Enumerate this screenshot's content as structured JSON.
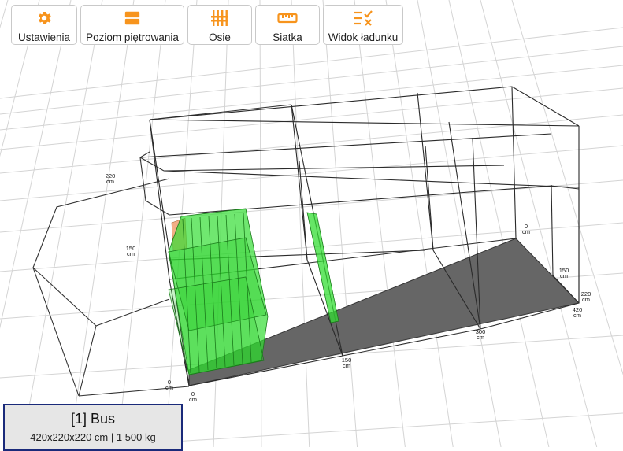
{
  "toolbar": {
    "buttons": [
      {
        "label": "Ustawienia",
        "icon": "gear-icon"
      },
      {
        "label": "Poziom piętrowania",
        "icon": "stack-layers-icon"
      },
      {
        "label": "Osie",
        "icon": "axles-icon"
      },
      {
        "label": "Siatka",
        "icon": "ruler-icon"
      },
      {
        "label": "Widok ładunku",
        "icon": "list-check-icon"
      }
    ],
    "accent_color": "#f7941d"
  },
  "scene": {
    "ticks": [
      {
        "value": "220",
        "unit": "cm"
      },
      {
        "value": "150",
        "unit": "cm"
      },
      {
        "value": "0",
        "unit": "cm"
      },
      {
        "value": "0",
        "unit": "cm"
      },
      {
        "value": "150",
        "unit": "cm"
      },
      {
        "value": "300",
        "unit": "cm"
      },
      {
        "value": "420",
        "unit": "cm"
      },
      {
        "value": "220",
        "unit": "cm"
      },
      {
        "value": "150",
        "unit": "cm"
      },
      {
        "value": "0",
        "unit": "cm"
      }
    ],
    "colors": {
      "floor": "#666666",
      "cargo": "#33dd33",
      "highlight": "#f0a070",
      "grid": "#d4d4d4"
    }
  },
  "vehicle": {
    "title": "[1] Bus",
    "details": "420x220x220 cm | 1 500 kg"
  }
}
